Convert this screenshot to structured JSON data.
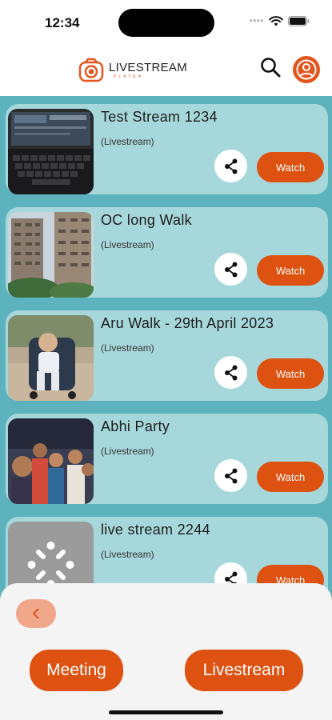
{
  "status": {
    "time": "12:34"
  },
  "header": {
    "logo_title": "LIVESTREAM",
    "logo_sub": "PLAYER",
    "brand_color": "#e2551c",
    "search_icon": "search-icon",
    "profile_icon": "account-icon"
  },
  "streams": [
    {
      "title": "Test Stream 1234",
      "type": "(Livestream)",
      "watch_label": "Watch",
      "thumb": "laptop-keyboard"
    },
    {
      "title": "OC long Walk",
      "type": "(Livestream)",
      "watch_label": "Watch",
      "thumb": "apartment-towers"
    },
    {
      "title": "Aru Walk - 29th April 2023",
      "type": "(Livestream)",
      "watch_label": "Watch",
      "thumb": "child-in-stroller"
    },
    {
      "title": "Abhi Party",
      "type": "(Livestream)",
      "watch_label": "Watch",
      "thumb": "group-selfie"
    },
    {
      "title": "live stream 2244",
      "type": "(Livestream)",
      "watch_label": "Watch",
      "thumb": "placeholder-logo"
    }
  ],
  "bottom": {
    "back_icon": "chevron-left-icon",
    "meeting_label": "Meeting",
    "livestream_label": "Livestream"
  }
}
